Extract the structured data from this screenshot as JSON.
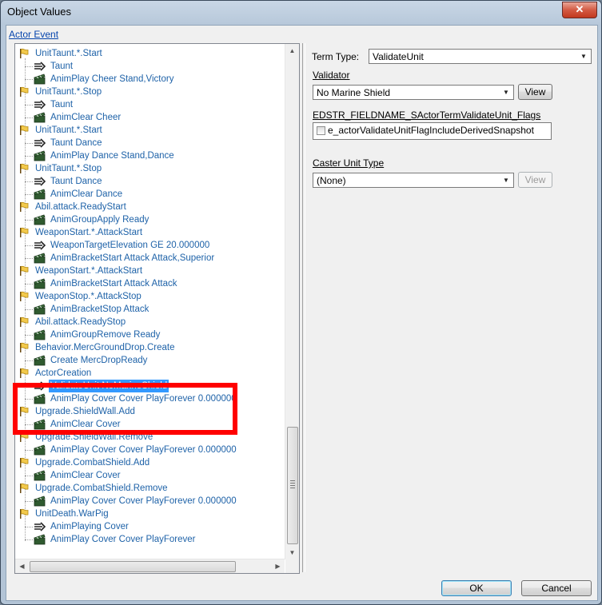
{
  "window": {
    "title": "Object Values",
    "close_glyph": "✕"
  },
  "actor_event_link": "Actor Event",
  "tree": {
    "rows": [
      {
        "text": "UnitTaunt.*.Start",
        "icon": "event-flag-icon",
        "depth": 0
      },
      {
        "text": "Taunt",
        "icon": "arrow-condition-icon",
        "depth": 1
      },
      {
        "text": "AnimPlay Cheer Stand,Victory",
        "icon": "clapper-action-icon",
        "depth": 1
      },
      {
        "text": "UnitTaunt.*.Stop",
        "icon": "event-flag-icon",
        "depth": 0
      },
      {
        "text": "Taunt",
        "icon": "arrow-condition-icon",
        "depth": 1
      },
      {
        "text": "AnimClear Cheer",
        "icon": "clapper-action-icon",
        "depth": 1
      },
      {
        "text": "UnitTaunt.*.Start",
        "icon": "event-flag-icon",
        "depth": 0
      },
      {
        "text": "Taunt Dance",
        "icon": "arrow-condition-icon",
        "depth": 1
      },
      {
        "text": "AnimPlay Dance Stand,Dance",
        "icon": "clapper-action-icon",
        "depth": 1
      },
      {
        "text": "UnitTaunt.*.Stop",
        "icon": "event-flag-icon",
        "depth": 0
      },
      {
        "text": "Taunt Dance",
        "icon": "arrow-condition-icon",
        "depth": 1
      },
      {
        "text": "AnimClear Dance",
        "icon": "clapper-action-icon",
        "depth": 1
      },
      {
        "text": "Abil.attack.ReadyStart",
        "icon": "event-flag-icon",
        "depth": 0
      },
      {
        "text": "AnimGroupApply Ready",
        "icon": "clapper-action-icon",
        "depth": 1
      },
      {
        "text": "WeaponStart.*.AttackStart",
        "icon": "event-flag-icon",
        "depth": 0
      },
      {
        "text": "WeaponTargetElevation GE 20.000000",
        "icon": "arrow-condition-icon",
        "depth": 1
      },
      {
        "text": "AnimBracketStart Attack Attack,Superior",
        "icon": "clapper-action-icon",
        "depth": 1
      },
      {
        "text": "WeaponStart.*.AttackStart",
        "icon": "event-flag-icon",
        "depth": 0
      },
      {
        "text": "AnimBracketStart Attack Attack",
        "icon": "clapper-action-icon",
        "depth": 1
      },
      {
        "text": "WeaponStop.*.AttackStop",
        "icon": "event-flag-icon",
        "depth": 0
      },
      {
        "text": "AnimBracketStop Attack",
        "icon": "clapper-action-icon",
        "depth": 1
      },
      {
        "text": "Abil.attack.ReadyStop",
        "icon": "event-flag-icon",
        "depth": 0
      },
      {
        "text": "AnimGroupRemove Ready",
        "icon": "clapper-action-icon",
        "depth": 1
      },
      {
        "text": "Behavior.MercGroundDrop.Create",
        "icon": "event-flag-icon",
        "depth": 0
      },
      {
        "text": "Create MercDropReady",
        "icon": "clapper-action-icon",
        "depth": 1,
        "obscured": true
      },
      {
        "text": "ActorCreation",
        "icon": "event-flag-icon",
        "depth": 0
      },
      {
        "text": "ValidateUnit NoMarineShield",
        "icon": "arrow-condition-icon",
        "depth": 1,
        "selected": true
      },
      {
        "text": "AnimPlay Cover Cover PlayForever 0.000000",
        "icon": "clapper-action-icon",
        "depth": 1
      },
      {
        "text": "Upgrade.ShieldWall.Add",
        "icon": "event-flag-icon",
        "depth": 0,
        "obscured": true
      },
      {
        "text": "AnimClear Cover",
        "icon": "clapper-action-icon",
        "depth": 1
      },
      {
        "text": "Upgrade.ShieldWall.Remove",
        "icon": "event-flag-icon",
        "depth": 0
      },
      {
        "text": "AnimPlay Cover Cover PlayForever 0.000000",
        "icon": "clapper-action-icon",
        "depth": 1
      },
      {
        "text": "Upgrade.CombatShield.Add",
        "icon": "event-flag-icon",
        "depth": 0
      },
      {
        "text": "AnimClear Cover",
        "icon": "clapper-action-icon",
        "depth": 1
      },
      {
        "text": "Upgrade.CombatShield.Remove",
        "icon": "event-flag-icon",
        "depth": 0
      },
      {
        "text": "AnimPlay Cover Cover PlayForever 0.000000",
        "icon": "clapper-action-icon",
        "depth": 1
      },
      {
        "text": "UnitDeath.WarPig",
        "icon": "event-flag-icon",
        "depth": 0
      },
      {
        "text": "AnimPlaying Cover",
        "icon": "arrow-condition-icon",
        "depth": 1
      },
      {
        "text": "AnimPlay Cover Cover PlayForever",
        "icon": "clapper-action-icon",
        "depth": 1
      }
    ],
    "scroll_up_glyph": "▲",
    "scroll_down_glyph": "▼",
    "scroll_left_glyph": "◀",
    "scroll_right_glyph": "▶",
    "highlight_color": "#ff0000"
  },
  "form": {
    "term_type_label": "Term Type:",
    "term_type_value": "ValidateUnit",
    "validator_label": "Validator",
    "validator_value": "No Marine Shield",
    "validator_view": "View",
    "flags_label": "EDSTR_FIELDNAME_SActorTermValidateUnit_Flags",
    "flags_item": "e_actorValidateUnitFlagIncludeDerivedSnapshot",
    "caster_label": "Caster Unit Type",
    "caster_value": "(None)",
    "caster_view": "View"
  },
  "footer": {
    "ok": "OK",
    "cancel": "Cancel"
  },
  "colors": {
    "link": "#0645ad",
    "tree_text": "#1e62a8",
    "selection": "#3399ff"
  }
}
